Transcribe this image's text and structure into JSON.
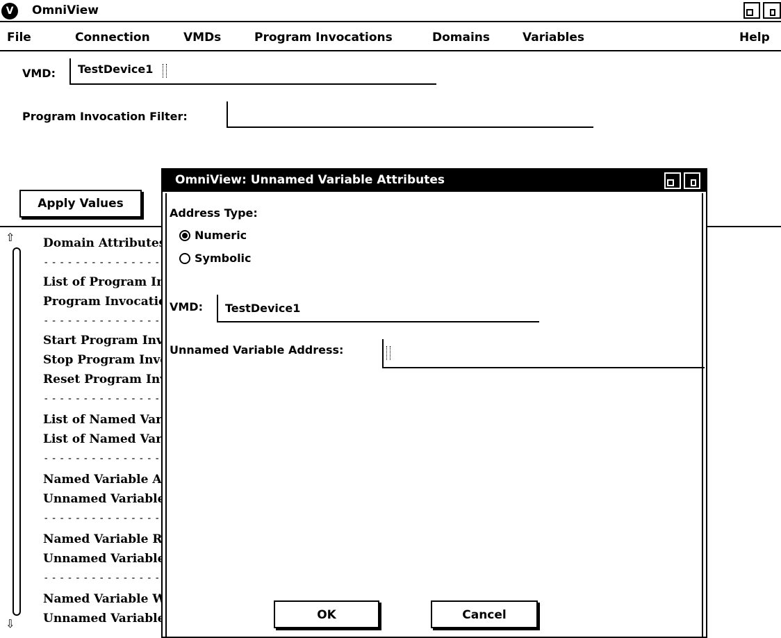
{
  "window": {
    "title": "OmniView",
    "logo_icon": "omniview-logo-icon"
  },
  "menubar": {
    "items": [
      "File",
      "Connection",
      "VMDs",
      "Program Invocations",
      "Domains",
      "Variables"
    ],
    "help": "Help"
  },
  "form": {
    "vmd_label": "VMD:",
    "vmd_value": "TestDevice1",
    "filter_label": "Program Invocation Filter:",
    "filter_value": "",
    "apply_label": "Apply Values"
  },
  "list": {
    "items": [
      "Domain Attributes",
      "--------------------",
      "List of Program Invocations",
      "Program Invocation Attributes",
      "--------------------",
      "Start Program Invocation",
      "Stop Program Invocation",
      "Reset Program Invocation",
      "--------------------",
      "List of Named Variables",
      "List of Named Variable Lists",
      "--------------------",
      "Named Variable Attributes",
      "Unnamed Variable Attributes",
      "--------------------",
      "Named Variable Read",
      "Unnamed Variable Read",
      "--------------------",
      "Named Variable Write",
      "Unnamed Variable Write"
    ]
  },
  "dialog": {
    "title": "OmniView: Unnamed Variable Attributes",
    "address_type_label": "Address Type:",
    "option_numeric": "Numeric",
    "option_symbolic": "Symbolic",
    "selected_option": "Numeric",
    "vmd_label": "VMD:",
    "vmd_value": "TestDevice1",
    "address_label": "Unnamed Variable Address:",
    "address_value": "",
    "ok_label": "OK",
    "cancel_label": "Cancel"
  }
}
